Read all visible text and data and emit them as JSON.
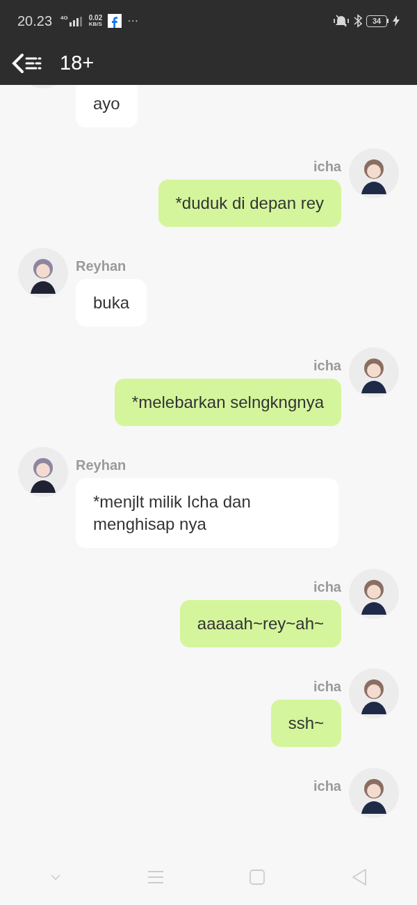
{
  "status_bar": {
    "time": "20.23",
    "network": "4G",
    "speed": "0.02",
    "speed_unit": "KB/S",
    "more": "···",
    "battery": "34"
  },
  "header": {
    "title": "18+"
  },
  "messages": [
    {
      "kind": "incoming",
      "text": "ayo"
    },
    {
      "kind": "outgoing",
      "sender": "icha",
      "text": "*duduk di depan rey"
    },
    {
      "kind": "incoming",
      "sender": "Reyhan",
      "text": "buka"
    },
    {
      "kind": "outgoing",
      "sender": "icha",
      "text": "*melebarkan selngkngnya"
    },
    {
      "kind": "incoming",
      "sender": "Reyhan",
      "text": "*menjlt milik Icha dan menghisap nya"
    },
    {
      "kind": "outgoing",
      "sender": "icha",
      "text": "aaaaah~rey~ah~"
    },
    {
      "kind": "outgoing",
      "sender": "icha",
      "text": "ssh~"
    },
    {
      "kind": "outgoing",
      "sender": "icha"
    }
  ]
}
